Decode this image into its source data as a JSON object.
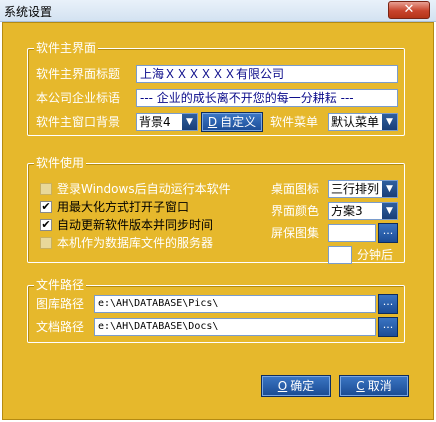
{
  "window": {
    "title": "系统设置",
    "close_glyph": "✕"
  },
  "main_group": {
    "title": "软件主界面",
    "caption_label": "软件主界面标题",
    "caption_value": "上海ＸＸＸＸＸＸ有限公司",
    "slogan_label": "本公司企业标语",
    "slogan_value": "--- 企业的成长离不开您的每一分耕耘 ---",
    "bg_label": "软件主窗口背景",
    "bg_value": "背景4",
    "custom_key": "D",
    "custom_text": "自定义",
    "menu_label": "软件菜单",
    "menu_value": "默认菜单"
  },
  "usage_group": {
    "title": "软件使用",
    "checkboxes": [
      {
        "label": "登录Windows后自动运行本软件",
        "checked": false
      },
      {
        "label": "用最大化方式打开子窗口",
        "checked": true
      },
      {
        "label": "自动更新软件版本并同步时间",
        "checked": true
      },
      {
        "label": "本机作为数据库文件的服务器",
        "checked": false
      }
    ],
    "desktop_icon_label": "桌面图标",
    "desktop_icon_value": "三行排列",
    "ui_color_label": "界面颜色",
    "ui_color_value": "方案3",
    "screensaver_label": "屏保图集",
    "screensaver_value": "",
    "minutes_value": "",
    "minutes_suffix": "分钟后"
  },
  "path_group": {
    "title": "文件路径",
    "pics_label": "图库路径",
    "pics_value": "e:\\AH\\DATABASE\\Pics\\",
    "docs_label": "文档路径",
    "docs_value": "e:\\AH\\DATABASE\\Docs\\"
  },
  "buttons": {
    "ok_key": "O",
    "ok_text": "确定",
    "cancel_key": "C",
    "cancel_text": "取消"
  },
  "common": {
    "dropdown_glyph": "▼",
    "browse_glyph": "..."
  },
  "colors": {
    "panel": "#e6b82c",
    "button": "#1b4c96",
    "label": "#ffffff"
  }
}
